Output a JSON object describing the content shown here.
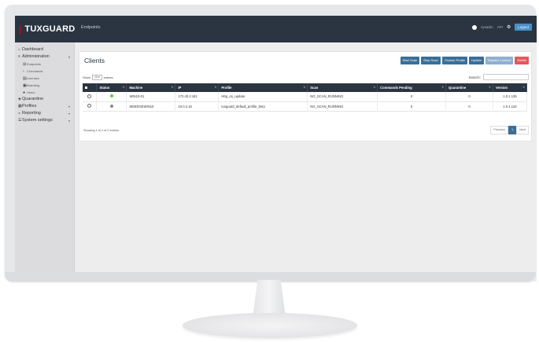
{
  "app": {
    "brand_name": "TUXGUARD",
    "brand_mark": "❘",
    "page_name": "Endpoints",
    "username": "sysadm",
    "api_label": "API",
    "logout_label": "Logout"
  },
  "sidebar": {
    "dashboard": "Dashboard",
    "administration": "Administration",
    "endpoints": "Endpoints",
    "commands": "Commands",
    "licenses": "Licenses",
    "branding": "Branding",
    "users": "Users",
    "quarantine": "Quarantine",
    "profiles": "Profiles",
    "reporting": "Reporting",
    "system_settings": "System settings"
  },
  "page": {
    "title": "Clients",
    "buttons": {
      "start_scan": "Start Scan",
      "stop_scan": "Stop Scan",
      "choose_profile": "Choose Profile",
      "update": "Update",
      "replace_license": "Replace License",
      "delete": "Delete"
    },
    "show_label": "Show",
    "entries_value": "10",
    "entries_label": "entries",
    "search_label": "Search:",
    "showing_text": "Showing 1 to 2 of 2 entries",
    "pagination": {
      "previous": "Previous",
      "current": "1",
      "next": "Next"
    }
  },
  "table": {
    "columns": {
      "status": "Status",
      "machine": "Machine",
      "ip": "IP",
      "profile": "Profile",
      "scan": "Scan",
      "commands_pending": "Commands Pending",
      "quarantine": "Quarantine",
      "version": "Version"
    },
    "rows": [
      {
        "status_color": "#6fbf3a",
        "machine": "WIN10-01",
        "ip": "172.40.2.181",
        "profile": "Http_on_update",
        "scan": "NO_SCAN_RUNNING",
        "commands_pending": "0",
        "quarantine": "0",
        "version": "1.0.1.135"
      },
      {
        "status_color": "#8a8a8a",
        "machine": "MSEDGEWIN10",
        "ip": "10.0.2.15",
        "profile": "tuxguard_default_profile_beta",
        "scan": "NO_SCAN_RUNNING",
        "commands_pending": "0",
        "quarantine": "0",
        "version": "1.0.1.132"
      }
    ]
  },
  "colors": {
    "topbar": "#2a3541",
    "accent_blue": "#3b6f98",
    "delete_red": "#e05a5a",
    "brand_red": "#d0021b"
  }
}
